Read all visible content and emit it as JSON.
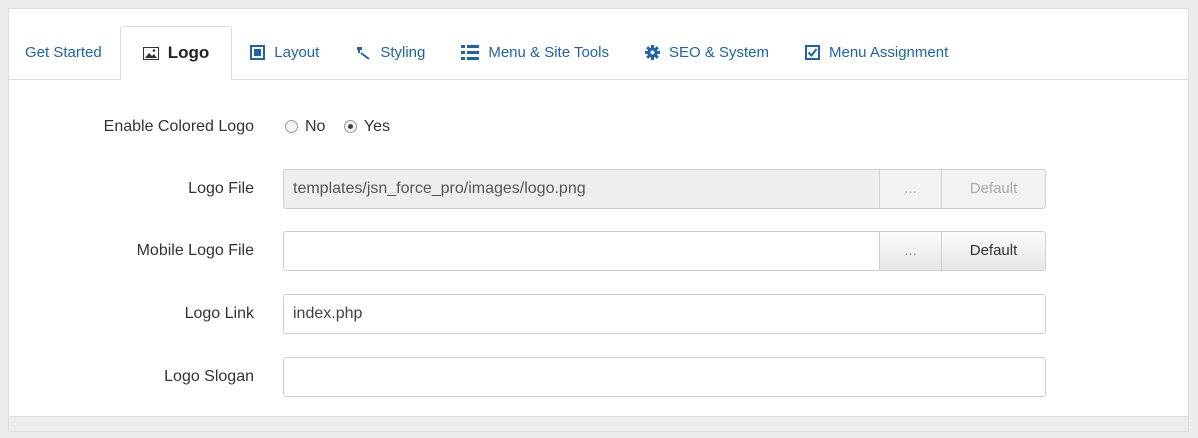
{
  "tabs": [
    {
      "label": "Get Started",
      "icon": "",
      "active": false
    },
    {
      "label": "Logo",
      "icon": "image-icon",
      "active": true
    },
    {
      "label": "Layout",
      "icon": "layout-icon",
      "active": false
    },
    {
      "label": "Styling",
      "icon": "brush-icon",
      "active": false
    },
    {
      "label": "Menu & Site Tools",
      "icon": "list-icon",
      "active": false
    },
    {
      "label": "SEO & System",
      "icon": "gear-icon",
      "active": false
    },
    {
      "label": "Menu Assignment",
      "icon": "checkbox-icon",
      "active": false
    }
  ],
  "form": {
    "enable_colored_logo": {
      "label": "Enable Colored Logo",
      "options": [
        "No",
        "Yes"
      ],
      "selected": "Yes"
    },
    "logo_file": {
      "label": "Logo File",
      "value": "templates/jsn_force_pro/images/logo.png",
      "browse_label": "...",
      "default_label": "Default",
      "disabled": true
    },
    "mobile_logo_file": {
      "label": "Mobile Logo File",
      "value": "",
      "browse_label": "...",
      "default_label": "Default"
    },
    "logo_link": {
      "label": "Logo Link",
      "value": "index.php"
    },
    "logo_slogan": {
      "label": "Logo Slogan",
      "value": ""
    }
  },
  "colors": {
    "tab_link": "#1f64a8",
    "icon_blue": "#1f64a8"
  }
}
